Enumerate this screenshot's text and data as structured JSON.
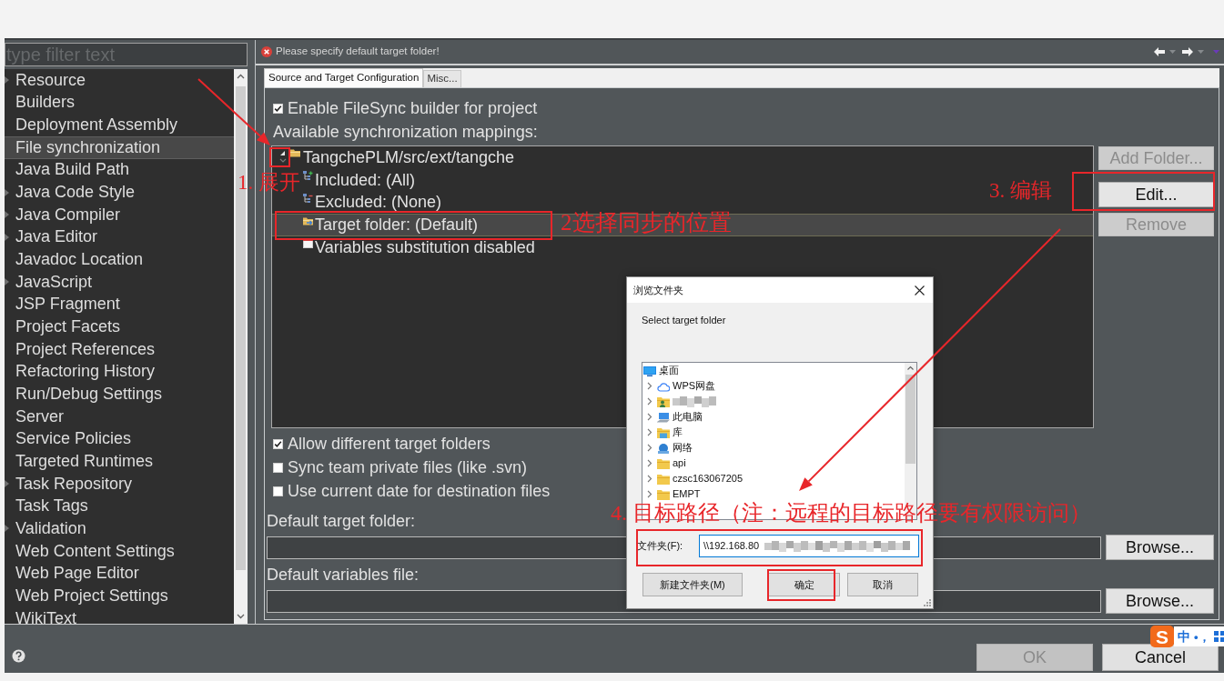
{
  "sidebar": {
    "filter": {
      "placeholder": "type filter text"
    },
    "items": [
      {
        "label": "Resource",
        "expandable": true,
        "selected": false
      },
      {
        "label": "Builders",
        "expandable": false,
        "selected": false
      },
      {
        "label": "Deployment Assembly",
        "expandable": false,
        "selected": false
      },
      {
        "label": "File synchronization",
        "expandable": false,
        "selected": true
      },
      {
        "label": "Java Build Path",
        "expandable": false,
        "selected": false
      },
      {
        "label": "Java Code Style",
        "expandable": true,
        "selected": false
      },
      {
        "label": "Java Compiler",
        "expandable": true,
        "selected": false
      },
      {
        "label": "Java Editor",
        "expandable": true,
        "selected": false
      },
      {
        "label": "Javadoc Location",
        "expandable": false,
        "selected": false
      },
      {
        "label": "JavaScript",
        "expandable": true,
        "selected": false
      },
      {
        "label": "JSP Fragment",
        "expandable": false,
        "selected": false
      },
      {
        "label": "Project Facets",
        "expandable": false,
        "selected": false
      },
      {
        "label": "Project References",
        "expandable": false,
        "selected": false
      },
      {
        "label": "Refactoring History",
        "expandable": false,
        "selected": false
      },
      {
        "label": "Run/Debug Settings",
        "expandable": false,
        "selected": false
      },
      {
        "label": "Server",
        "expandable": false,
        "selected": false
      },
      {
        "label": "Service Policies",
        "expandable": false,
        "selected": false
      },
      {
        "label": "Targeted Runtimes",
        "expandable": false,
        "selected": false
      },
      {
        "label": "Task Repository",
        "expandable": true,
        "selected": false
      },
      {
        "label": "Task Tags",
        "expandable": false,
        "selected": false
      },
      {
        "label": "Validation",
        "expandable": true,
        "selected": false
      },
      {
        "label": "Web Content Settings",
        "expandable": false,
        "selected": false
      },
      {
        "label": "Web Page Editor",
        "expandable": false,
        "selected": false
      },
      {
        "label": "Web Project Settings",
        "expandable": false,
        "selected": false
      },
      {
        "label": "WikiText",
        "expandable": false,
        "selected": false
      }
    ]
  },
  "header": {
    "error": "Please specify default target folder!"
  },
  "tabs": [
    {
      "label": "Source and Target Configuration",
      "selected": true
    },
    {
      "label": "Misc...",
      "selected": false
    }
  ],
  "builder_option": {
    "label": "Enable FileSync builder for project",
    "checked": true
  },
  "mappings": {
    "label": "Available synchronization mappings:",
    "items": [
      {
        "label": "TangchePLM/src/ext/tangche",
        "kind": "project",
        "expanded": true,
        "selected": false,
        "children": [
          {
            "label": "Included: (All)",
            "kind": "included",
            "selected": false
          },
          {
            "label": "Excluded: (None)",
            "kind": "excluded",
            "selected": false
          },
          {
            "label": "Target folder: (Default)",
            "kind": "target",
            "selected": true
          },
          {
            "label": "Variables substitution disabled",
            "kind": "variables",
            "selected": false
          }
        ]
      }
    ],
    "buttons": [
      {
        "label": "Add Folder...",
        "disabled": true
      },
      {
        "label": "Edit...",
        "disabled": false
      },
      {
        "label": "Remove",
        "disabled": true
      }
    ]
  },
  "sync_options": [
    {
      "label": "Allow different target folders",
      "checked": true
    },
    {
      "label": "Sync team private files (like .svn)",
      "checked": false
    },
    {
      "label": "Use current date for destination files",
      "checked": false
    }
  ],
  "path_fields": [
    {
      "label": "Default target folder:",
      "button": "Browse..."
    },
    {
      "label": "Default variables file:",
      "button": "Browse..."
    }
  ],
  "footer": {
    "buttons": [
      {
        "label": "OK",
        "disabled": true
      },
      {
        "label": "Cancel",
        "disabled": false
      }
    ]
  },
  "folder_dialog": {
    "title": "浏览文件夹",
    "prompt": "Select target folder",
    "tree": [
      {
        "label": "桌面",
        "kind": "desktop",
        "children": [
          {
            "label": "WPS网盘",
            "kind": "cloud",
            "expanded": false
          },
          {
            "kind": "user",
            "redacted": true,
            "expanded": false
          },
          {
            "label": "此电脑",
            "kind": "computer",
            "expanded": false
          },
          {
            "label": "库",
            "kind": "library",
            "expanded": false
          },
          {
            "label": "网络",
            "kind": "network",
            "expanded": false
          },
          {
            "label": "api",
            "kind": "folder",
            "expanded": false
          },
          {
            "label": "czsc163067205",
            "kind": "folder",
            "expanded": false
          },
          {
            "label": "EMPT",
            "kind": "folder",
            "expanded": false
          }
        ]
      }
    ],
    "folder_field": {
      "label": "文件夹(F):",
      "value": "\\\\192.168.80",
      "redacted": true
    },
    "buttons": [
      {
        "label": "新建文件夹(M)"
      },
      {
        "label": "确定"
      },
      {
        "label": "取消"
      }
    ]
  },
  "annotations": [
    "1. 展开",
    "2选择同步的位置",
    "3. 编辑",
    "4. 目标路径（注：远程的目标路径要有权限访问）"
  ],
  "ime": {
    "logo": "S",
    "mode": "中",
    "punctuation": "•，"
  }
}
